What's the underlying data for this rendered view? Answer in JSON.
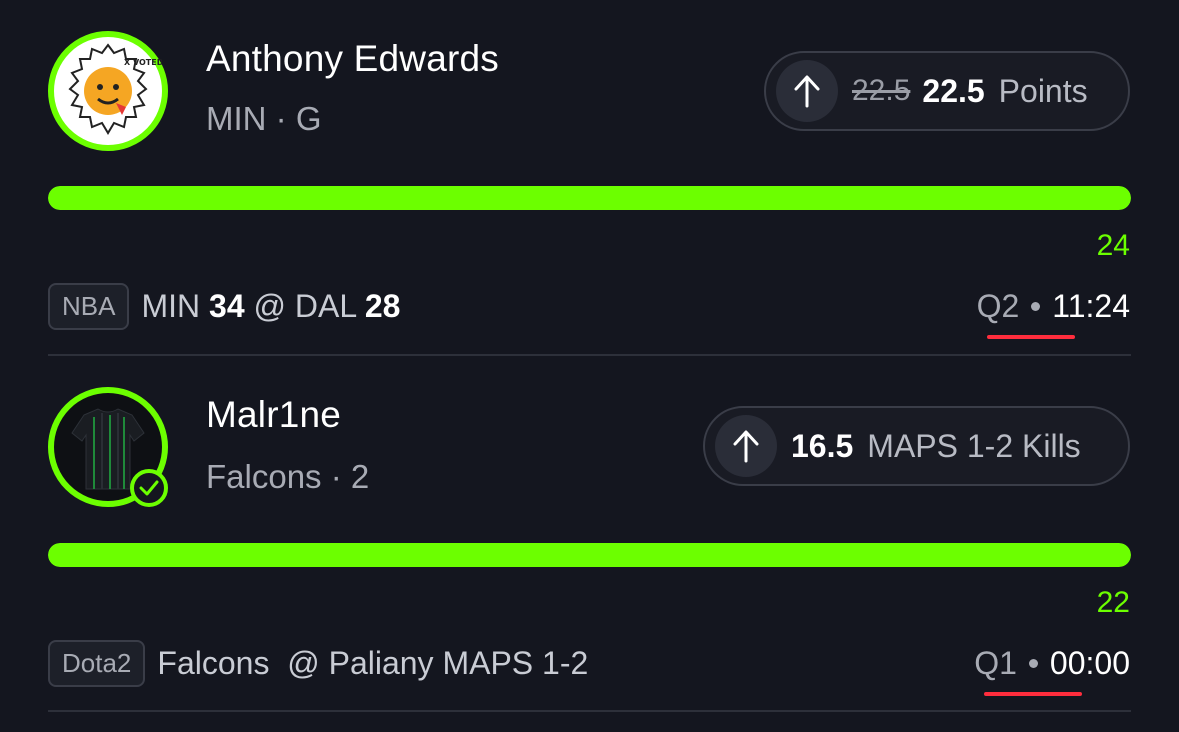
{
  "picks": [
    {
      "player_name": "Anthony Edwards",
      "player_meta": "MIN · G",
      "avatar_icon": "x-voted-sticker-avatar",
      "direction_icon": "arrow-up-icon",
      "old_line": "22.5",
      "line": "22.5",
      "stat": "Points",
      "progress": 1.0,
      "current_value": "24",
      "league": "NBA",
      "matchup_away": "MIN",
      "score_away": "34",
      "matchup_sep": "@",
      "matchup_home": "DAL",
      "score_home": "28",
      "period": "Q2",
      "clock": "11:24"
    },
    {
      "player_name": "Malr1ne",
      "player_meta": "Falcons · 2",
      "avatar_icon": "jersey-avatar",
      "badge_icon": "check-icon",
      "direction_icon": "arrow-up-icon",
      "line": "16.5",
      "stat": "MAPS 1-2 Kills",
      "progress": 1.0,
      "current_value": "22",
      "league": "Dota2",
      "matchup_text": "Falcons  @ Paliany MAPS 1-2",
      "period": "Q1",
      "clock": "00:00"
    }
  ],
  "colors": {
    "accent": "#6cff00",
    "background": "#14161f",
    "highlight_underline": "#ff2d3d"
  }
}
